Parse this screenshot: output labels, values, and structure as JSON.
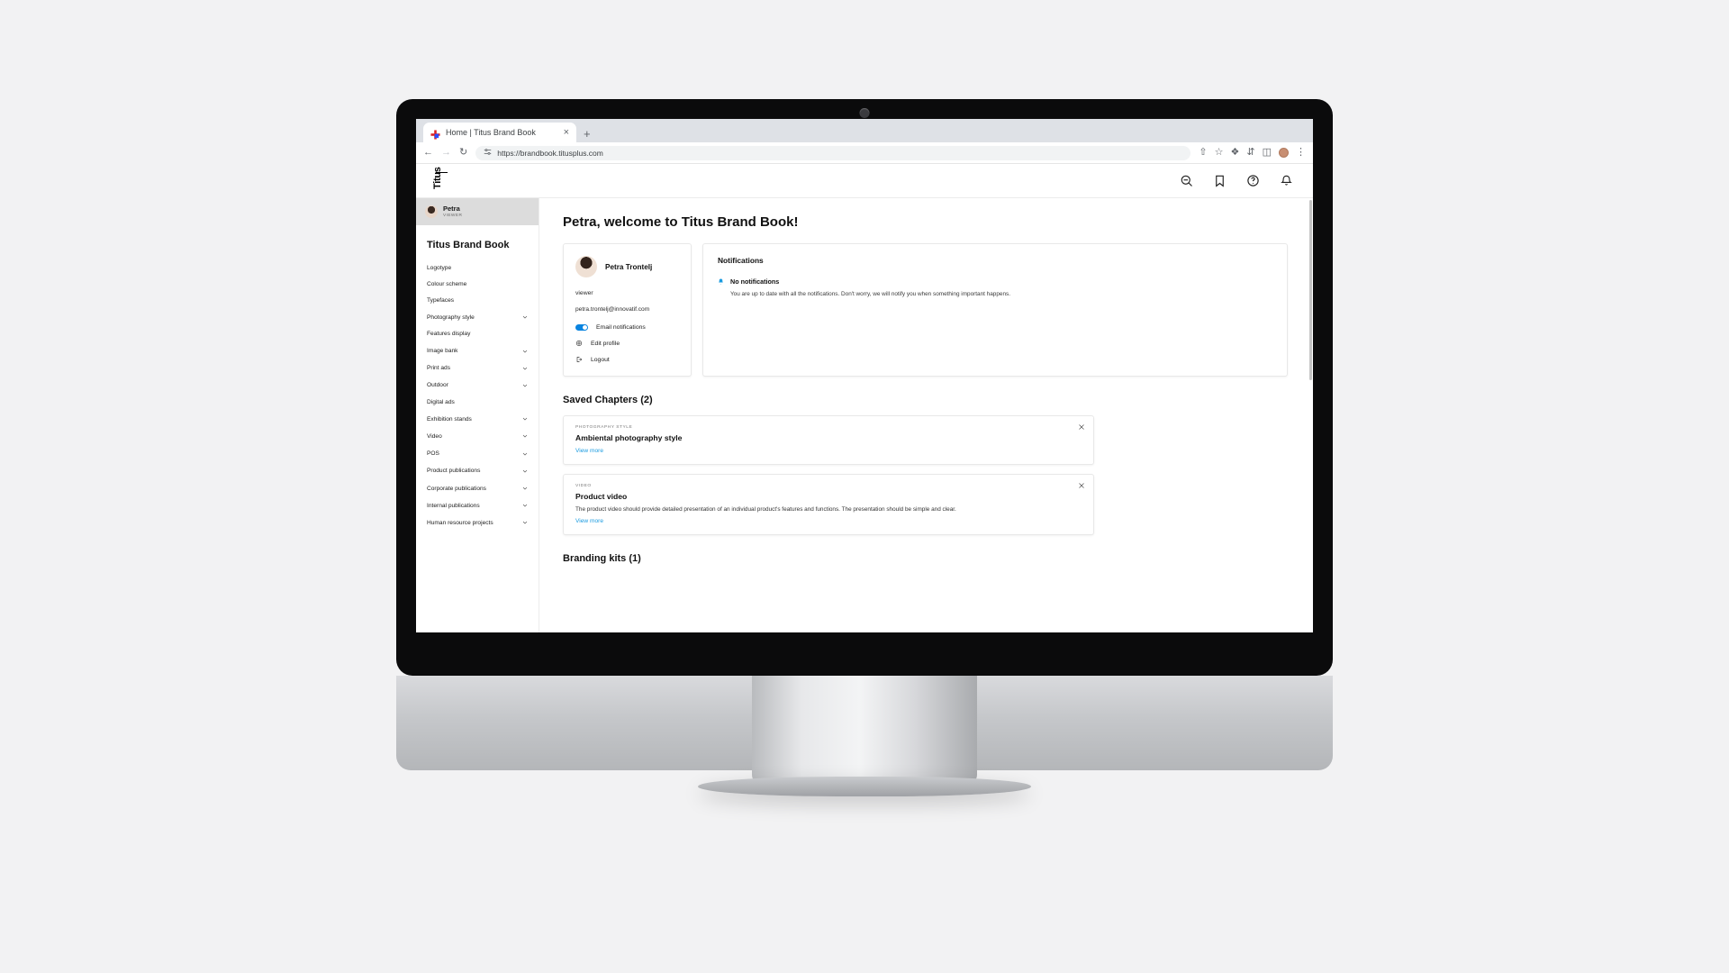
{
  "browser": {
    "tab_title": "Home | Titus Brand Book",
    "favicon": "titus-logo-favicon",
    "close_tab": "×",
    "new_tab": "+",
    "back": "←",
    "forward": "→",
    "reload": "↻",
    "site_settings_icon": "tune-icon",
    "url": "https://brandbook.titusplus.com",
    "share_icon": "⇧",
    "bookmark_icon": "☆",
    "extensions_icon": "❖",
    "split_icon": "⇵",
    "sidepanel_icon": "◫",
    "menu_icon": "⋮"
  },
  "app": {
    "logo_text": "Titus",
    "header_icons": [
      {
        "name": "search-icon"
      },
      {
        "name": "bookmark-icon"
      },
      {
        "name": "help-icon"
      },
      {
        "name": "notification-bell-icon"
      }
    ]
  },
  "sidebar": {
    "user": {
      "name": "Petra",
      "role": "VIEWER"
    },
    "title": "Titus Brand Book",
    "items": [
      {
        "label": "Logotype",
        "expandable": false
      },
      {
        "label": "Colour scheme",
        "expandable": false
      },
      {
        "label": "Typefaces",
        "expandable": false
      },
      {
        "label": "Photography style",
        "expandable": true
      },
      {
        "label": "Features display",
        "expandable": false
      },
      {
        "label": "Image bank",
        "expandable": true
      },
      {
        "label": "Print ads",
        "expandable": true
      },
      {
        "label": "Outdoor",
        "expandable": true
      },
      {
        "label": "Digital ads",
        "expandable": false
      },
      {
        "label": "Exhibition stands",
        "expandable": true
      },
      {
        "label": "Video",
        "expandable": true
      },
      {
        "label": "POS",
        "expandable": true
      },
      {
        "label": "Product publications",
        "expandable": true
      },
      {
        "label": "Corporate publications",
        "expandable": true
      },
      {
        "label": "Internal publications",
        "expandable": true
      },
      {
        "label": "Human resource projects",
        "expandable": true
      }
    ]
  },
  "main": {
    "page_title": "Petra, welcome to Titus Brand Book!",
    "profile": {
      "name": "Petra Trontelj",
      "role": "viewer",
      "email": "petra.trontelj@innovatif.com",
      "actions": [
        {
          "label": "Email notifications",
          "type": "toggle",
          "enabled": true
        },
        {
          "label": "Edit profile",
          "type": "link",
          "icon": "gear-icon"
        },
        {
          "label": "Logout",
          "type": "link",
          "icon": "logout-icon"
        }
      ]
    },
    "notifications": {
      "title": "Notifications",
      "empty_title": "No notifications",
      "empty_text": "You are up to date with all the notifications. Don't worry, we will notify you when something important happens."
    },
    "saved_chapters": {
      "title": "Saved Chapters (2)",
      "items": [
        {
          "category": "PHOTOGRAPHY STYLE",
          "title": "Ambiental photography style",
          "description": "",
          "link": "View more"
        },
        {
          "category": "VIDEO",
          "title": "Product video",
          "description": "The product video should provide detailed presentation of an individual product's features and functions. The presentation should be simple and clear.",
          "link": "View more"
        }
      ]
    },
    "branding_kits": {
      "title": "Branding kits (1)"
    }
  },
  "colors": {
    "accent": "#1a9be0",
    "toggle_on": "#0a84e0",
    "chip_bg": "#dcdcdc"
  }
}
